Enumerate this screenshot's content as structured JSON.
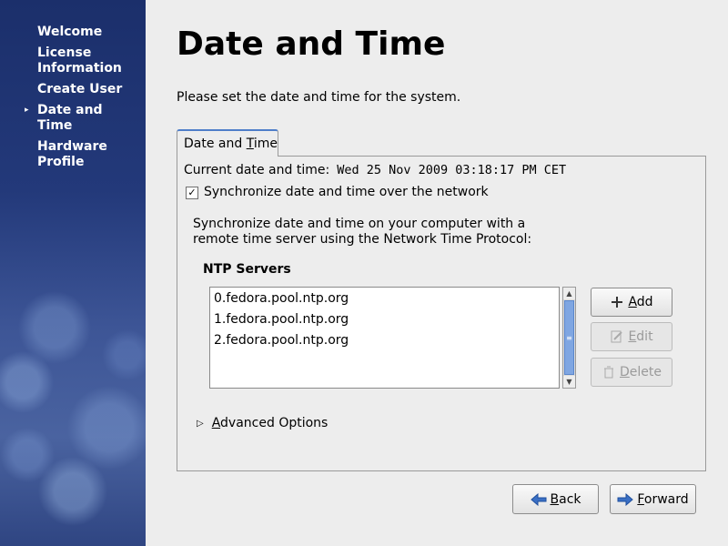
{
  "sidebar": {
    "items": [
      {
        "label": "Welcome"
      },
      {
        "label": "License Information"
      },
      {
        "label": "Create User"
      },
      {
        "label": "Date and Time",
        "active": true
      },
      {
        "label": "Hardware Profile"
      }
    ]
  },
  "page": {
    "title": "Date and Time",
    "subtitle": "Please set the date and time for the system."
  },
  "tab": {
    "label_pre": "Date and ",
    "label_ul": "T",
    "label_post": "ime"
  },
  "datetime": {
    "current_label": "Current date and time:",
    "current_value": "Wed 25 Nov 2009 03:18:17 PM CET",
    "sync_checked": true,
    "sync_label": "Synchronize date and time over the network",
    "description_line1": "Synchronize date and time on your computer with a",
    "description_line2": "remote time server using the Network Time Protocol:"
  },
  "ntp": {
    "heading": "NTP Servers",
    "servers": [
      "0.fedora.pool.ntp.org",
      "1.fedora.pool.ntp.org",
      "2.fedora.pool.ntp.org"
    ],
    "add_ul": "A",
    "add_rest": "dd",
    "edit_ul": "E",
    "edit_rest": "dit",
    "delete_ul": "D",
    "delete_rest": "elete"
  },
  "advanced": {
    "ul": "A",
    "rest": "dvanced Options"
  },
  "nav": {
    "back_ul": "B",
    "back_rest": "ack",
    "forward_ul": "F",
    "forward_rest": "orward"
  },
  "colors": {
    "sidebar": "#23397a",
    "accent": "#4f7ec9",
    "arrow": "#3a6fc4"
  }
}
